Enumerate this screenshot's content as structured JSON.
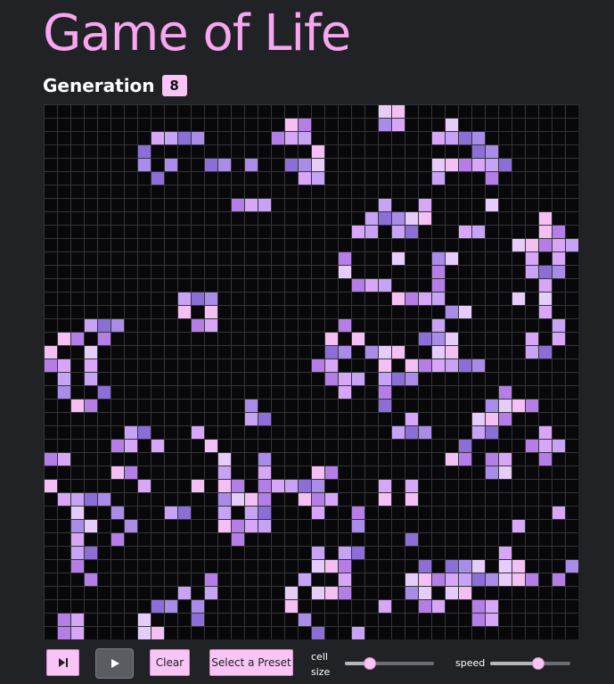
{
  "app": {
    "title": "Game of Life",
    "generation_label": "Generation",
    "generation": "8"
  },
  "board": {
    "columns": 40,
    "rows": 40,
    "dead_color": "#08080a",
    "grid_color": "#34343a",
    "palette": [
      "#c6a3f4",
      "#a98ce8",
      "#f4c0f3",
      "#d7a6f7",
      "#8b6fd6",
      "#e6cdf9",
      "#b57ee6"
    ],
    "live_cells": [
      [
        0,
        25
      ],
      [
        0,
        26
      ],
      [
        1,
        26
      ],
      [
        1,
        25
      ],
      [
        1,
        18
      ],
      [
        1,
        19
      ],
      [
        1,
        30
      ],
      [
        2,
        8
      ],
      [
        2,
        9
      ],
      [
        2,
        10
      ],
      [
        2,
        11
      ],
      [
        2,
        17
      ],
      [
        2,
        18
      ],
      [
        2,
        19
      ],
      [
        2,
        29
      ],
      [
        2,
        30
      ],
      [
        2,
        31
      ],
      [
        2,
        32
      ],
      [
        3,
        7
      ],
      [
        3,
        20
      ],
      [
        3,
        32
      ],
      [
        3,
        33
      ],
      [
        4,
        7
      ],
      [
        4,
        9
      ],
      [
        4,
        12
      ],
      [
        4,
        13
      ],
      [
        4,
        15
      ],
      [
        4,
        18
      ],
      [
        4,
        19
      ],
      [
        4,
        20
      ],
      [
        4,
        29
      ],
      [
        4,
        30
      ],
      [
        4,
        31
      ],
      [
        4,
        32
      ],
      [
        4,
        33
      ],
      [
        4,
        34
      ],
      [
        5,
        8
      ],
      [
        5,
        19
      ],
      [
        5,
        20
      ],
      [
        5,
        29
      ],
      [
        5,
        33
      ],
      [
        7,
        14
      ],
      [
        7,
        15
      ],
      [
        7,
        16
      ],
      [
        7,
        25
      ],
      [
        7,
        28
      ],
      [
        7,
        33
      ],
      [
        8,
        24
      ],
      [
        8,
        25
      ],
      [
        8,
        26
      ],
      [
        8,
        27
      ],
      [
        8,
        28
      ],
      [
        8,
        37
      ],
      [
        9,
        23
      ],
      [
        9,
        24
      ],
      [
        9,
        26
      ],
      [
        9,
        27
      ],
      [
        9,
        31
      ],
      [
        9,
        32
      ],
      [
        9,
        37
      ],
      [
        9,
        38
      ],
      [
        10,
        35
      ],
      [
        10,
        36
      ],
      [
        10,
        37
      ],
      [
        10,
        38
      ],
      [
        10,
        39
      ],
      [
        11,
        22
      ],
      [
        11,
        26
      ],
      [
        11,
        29
      ],
      [
        11,
        30
      ],
      [
        11,
        36
      ],
      [
        11,
        38
      ],
      [
        12,
        22
      ],
      [
        12,
        29
      ],
      [
        12,
        36
      ],
      [
        12,
        37
      ],
      [
        12,
        38
      ],
      [
        13,
        23
      ],
      [
        13,
        24
      ],
      [
        13,
        25
      ],
      [
        13,
        29
      ],
      [
        13,
        37
      ],
      [
        14,
        10
      ],
      [
        14,
        11
      ],
      [
        14,
        12
      ],
      [
        14,
        26
      ],
      [
        14,
        27
      ],
      [
        14,
        28
      ],
      [
        14,
        29
      ],
      [
        14,
        35
      ],
      [
        14,
        37
      ],
      [
        15,
        10
      ],
      [
        15,
        12
      ],
      [
        15,
        30
      ],
      [
        15,
        31
      ],
      [
        15,
        37
      ],
      [
        16,
        3
      ],
      [
        16,
        4
      ],
      [
        16,
        5
      ],
      [
        16,
        11
      ],
      [
        16,
        12
      ],
      [
        16,
        22
      ],
      [
        16,
        29
      ],
      [
        16,
        38
      ],
      [
        17,
        1
      ],
      [
        17,
        2
      ],
      [
        17,
        4
      ],
      [
        17,
        21
      ],
      [
        17,
        23
      ],
      [
        17,
        28
      ],
      [
        17,
        29
      ],
      [
        17,
        30
      ],
      [
        17,
        36
      ],
      [
        17,
        38
      ],
      [
        18,
        0
      ],
      [
        18,
        3
      ],
      [
        18,
        21
      ],
      [
        18,
        22
      ],
      [
        18,
        24
      ],
      [
        18,
        25
      ],
      [
        18,
        26
      ],
      [
        18,
        29
      ],
      [
        18,
        30
      ],
      [
        18,
        36
      ],
      [
        18,
        37
      ],
      [
        19,
        0
      ],
      [
        19,
        1
      ],
      [
        19,
        3
      ],
      [
        19,
        20
      ],
      [
        19,
        21
      ],
      [
        19,
        25
      ],
      [
        19,
        27
      ],
      [
        19,
        28
      ],
      [
        19,
        29
      ],
      [
        19,
        30
      ],
      [
        19,
        31
      ],
      [
        19,
        32
      ],
      [
        20,
        1
      ],
      [
        20,
        3
      ],
      [
        20,
        21
      ],
      [
        20,
        22
      ],
      [
        20,
        23
      ],
      [
        20,
        25
      ],
      [
        20,
        26
      ],
      [
        20,
        27
      ],
      [
        21,
        1
      ],
      [
        21,
        4
      ],
      [
        21,
        22
      ],
      [
        21,
        25
      ],
      [
        21,
        34
      ],
      [
        22,
        2
      ],
      [
        22,
        3
      ],
      [
        22,
        15
      ],
      [
        22,
        25
      ],
      [
        22,
        33
      ],
      [
        22,
        34
      ],
      [
        22,
        35
      ],
      [
        22,
        36
      ],
      [
        23,
        15
      ],
      [
        23,
        16
      ],
      [
        23,
        27
      ],
      [
        23,
        32
      ],
      [
        23,
        33
      ],
      [
        23,
        34
      ],
      [
        24,
        6
      ],
      [
        24,
        7
      ],
      [
        24,
        11
      ],
      [
        24,
        26
      ],
      [
        24,
        27
      ],
      [
        24,
        28
      ],
      [
        24,
        32
      ],
      [
        24,
        33
      ],
      [
        24,
        37
      ],
      [
        25,
        5
      ],
      [
        25,
        6
      ],
      [
        25,
        8
      ],
      [
        25,
        12
      ],
      [
        25,
        31
      ],
      [
        25,
        36
      ],
      [
        25,
        37
      ],
      [
        25,
        38
      ],
      [
        26,
        0
      ],
      [
        26,
        1
      ],
      [
        26,
        13
      ],
      [
        26,
        16
      ],
      [
        26,
        30
      ],
      [
        26,
        31
      ],
      [
        26,
        33
      ],
      [
        26,
        34
      ],
      [
        26,
        37
      ],
      [
        27,
        5
      ],
      [
        27,
        6
      ],
      [
        27,
        13
      ],
      [
        27,
        16
      ],
      [
        27,
        20
      ],
      [
        27,
        21
      ],
      [
        27,
        33
      ],
      [
        27,
        34
      ],
      [
        28,
        0
      ],
      [
        28,
        7
      ],
      [
        28,
        11
      ],
      [
        28,
        13
      ],
      [
        28,
        14
      ],
      [
        28,
        16
      ],
      [
        28,
        17
      ],
      [
        28,
        18
      ],
      [
        28,
        19
      ],
      [
        28,
        20
      ],
      [
        28,
        25
      ],
      [
        28,
        27
      ],
      [
        29,
        1
      ],
      [
        29,
        2
      ],
      [
        29,
        3
      ],
      [
        29,
        4
      ],
      [
        29,
        13
      ],
      [
        29,
        14
      ],
      [
        29,
        15
      ],
      [
        29,
        16
      ],
      [
        29,
        19
      ],
      [
        29,
        20
      ],
      [
        29,
        21
      ],
      [
        29,
        25
      ],
      [
        29,
        27
      ],
      [
        30,
        2
      ],
      [
        30,
        5
      ],
      [
        30,
        9
      ],
      [
        30,
        10
      ],
      [
        30,
        13
      ],
      [
        30,
        15
      ],
      [
        30,
        16
      ],
      [
        30,
        20
      ],
      [
        30,
        23
      ],
      [
        30,
        38
      ],
      [
        31,
        2
      ],
      [
        31,
        3
      ],
      [
        31,
        6
      ],
      [
        31,
        13
      ],
      [
        31,
        14
      ],
      [
        31,
        15
      ],
      [
        31,
        16
      ],
      [
        31,
        23
      ],
      [
        31,
        35
      ],
      [
        32,
        2
      ],
      [
        32,
        5
      ],
      [
        32,
        14
      ],
      [
        32,
        27
      ],
      [
        33,
        2
      ],
      [
        33,
        3
      ],
      [
        33,
        20
      ],
      [
        33,
        22
      ],
      [
        33,
        23
      ],
      [
        33,
        34
      ],
      [
        34,
        2
      ],
      [
        34,
        20
      ],
      [
        34,
        21
      ],
      [
        34,
        22
      ],
      [
        34,
        28
      ],
      [
        34,
        30
      ],
      [
        34,
        31
      ],
      [
        34,
        32
      ],
      [
        34,
        34
      ],
      [
        34,
        35
      ],
      [
        34,
        39
      ],
      [
        35,
        3
      ],
      [
        35,
        12
      ],
      [
        35,
        19
      ],
      [
        35,
        22
      ],
      [
        35,
        27
      ],
      [
        35,
        28
      ],
      [
        35,
        29
      ],
      [
        35,
        30
      ],
      [
        35,
        31
      ],
      [
        35,
        32
      ],
      [
        35,
        33
      ],
      [
        35,
        34
      ],
      [
        35,
        35
      ],
      [
        35,
        36
      ],
      [
        35,
        38
      ],
      [
        36,
        10
      ],
      [
        36,
        12
      ],
      [
        36,
        18
      ],
      [
        36,
        20
      ],
      [
        36,
        21
      ],
      [
        36,
        22
      ],
      [
        36,
        27
      ],
      [
        36,
        28
      ],
      [
        36,
        30
      ],
      [
        36,
        31
      ],
      [
        37,
        8
      ],
      [
        37,
        9
      ],
      [
        37,
        11
      ],
      [
        37,
        18
      ],
      [
        37,
        25
      ],
      [
        37,
        28
      ],
      [
        37,
        29
      ],
      [
        37,
        32
      ],
      [
        37,
        33
      ],
      [
        38,
        1
      ],
      [
        38,
        2
      ],
      [
        38,
        7
      ],
      [
        38,
        11
      ],
      [
        38,
        19
      ],
      [
        38,
        32
      ],
      [
        38,
        33
      ],
      [
        39,
        1
      ],
      [
        39,
        2
      ],
      [
        39,
        7
      ],
      [
        39,
        8
      ],
      [
        39,
        20
      ],
      [
        39,
        23
      ]
    ]
  },
  "controls": {
    "step_icon": "step-forward-icon",
    "play_icon": "play-icon",
    "clear_label": "Clear",
    "preset_label": "Select a Preset",
    "cell_size_label": "cell size",
    "speed_label": "speed",
    "cell_size_level": 0.28,
    "speed_level": 0.6
  }
}
